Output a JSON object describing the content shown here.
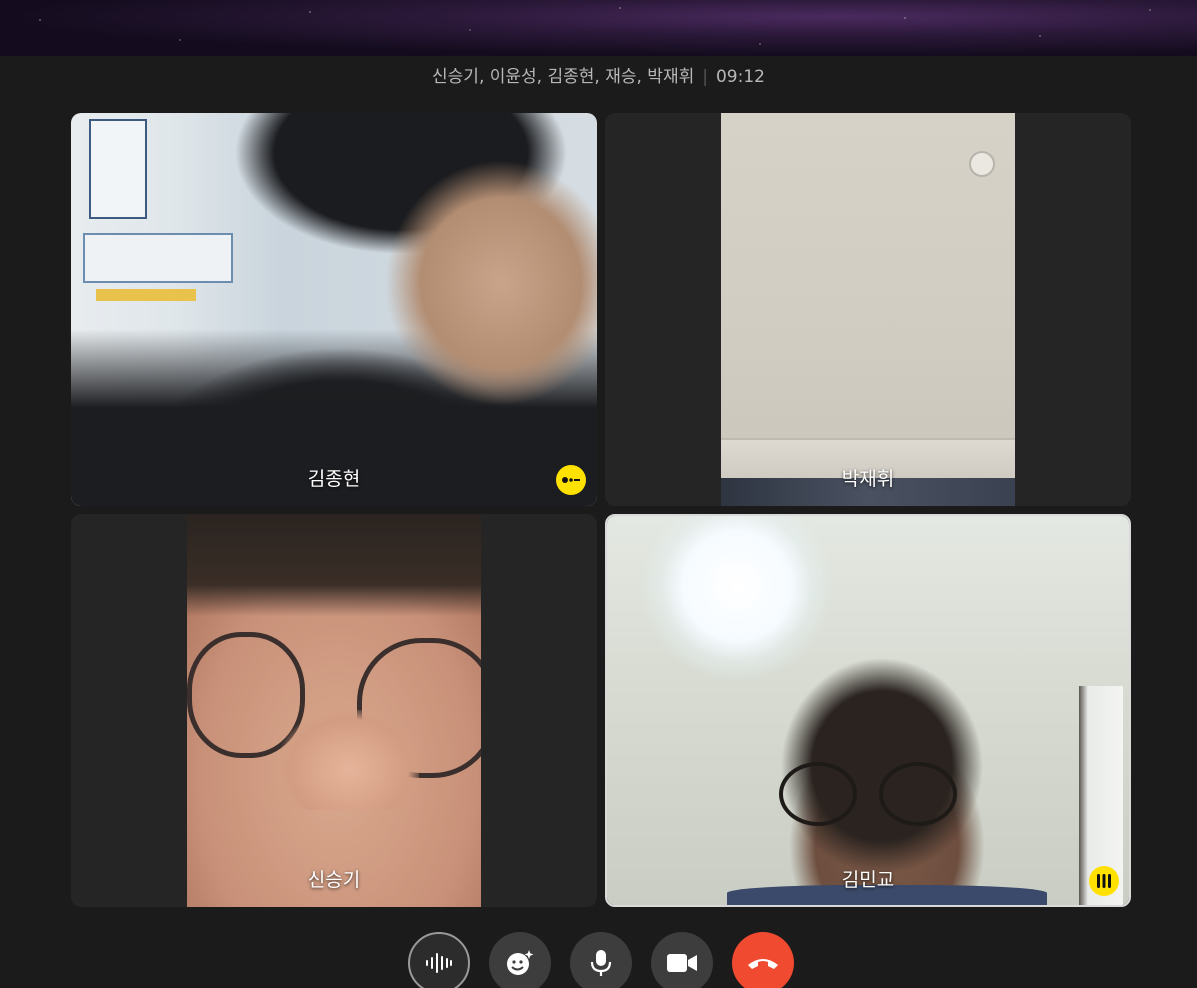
{
  "call": {
    "participants_label": "신승기, 이윤성, 김종현, 재승, 박재휘",
    "duration": "09:12"
  },
  "tiles": [
    {
      "name": "김종현",
      "status_icon": "emoticon-face-icon"
    },
    {
      "name": "박재휘"
    },
    {
      "name": "신승기"
    },
    {
      "name": "김민교",
      "status_icon": "speaking-bars-icon",
      "active": true
    }
  ],
  "controls": [
    {
      "icon": "voice-filter-icon"
    },
    {
      "icon": "face-effect-icon"
    },
    {
      "icon": "microphone-icon"
    },
    {
      "icon": "camera-icon"
    },
    {
      "icon": "hang-up-icon"
    }
  ],
  "colors": {
    "background": "#1b1b1b",
    "tile": "#252525",
    "badge": "#ffe100",
    "hangup": "#f04a30",
    "control": "#3d3d3d"
  }
}
